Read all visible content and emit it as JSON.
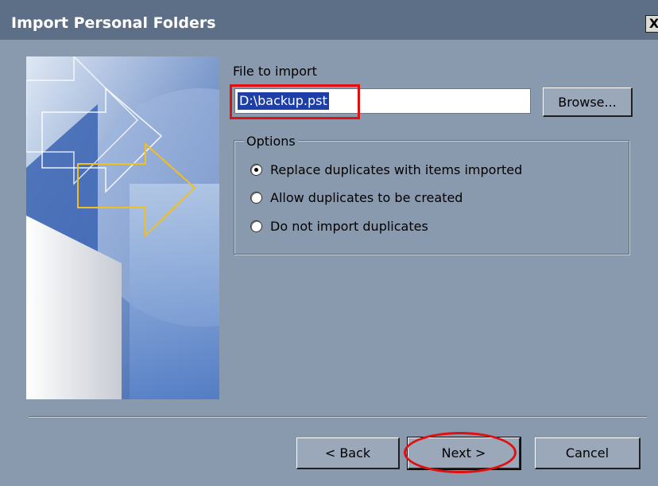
{
  "window": {
    "title": "Import Personal Folders",
    "close_label": "X"
  },
  "file": {
    "label": "File to import",
    "value": "D:\\backup.pst"
  },
  "browse_label": "Browse...",
  "options": {
    "legend": "Options",
    "items": [
      {
        "label": "Replace duplicates with items imported",
        "checked": true
      },
      {
        "label": "Allow duplicates to be created",
        "checked": false
      },
      {
        "label": "Do not import duplicates",
        "checked": false
      }
    ]
  },
  "buttons": {
    "back": "< Back",
    "next": "Next >",
    "cancel": "Cancel"
  },
  "colors": {
    "highlight": "#e01010",
    "selection": "#1f3fa8",
    "dialog_bg": "#8a9aae"
  }
}
